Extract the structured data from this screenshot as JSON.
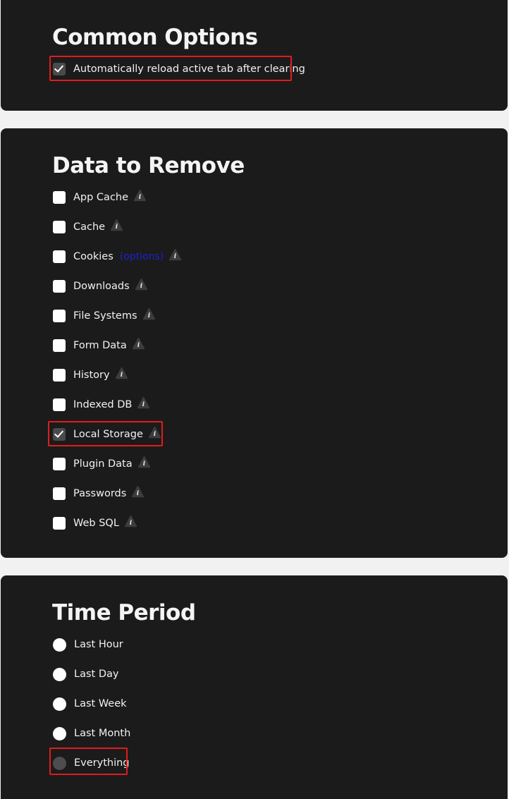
{
  "common": {
    "title": "Common Options",
    "options": [
      {
        "label": "Automatically reload active tab after clearing",
        "checked": true
      }
    ]
  },
  "data_to_remove": {
    "title": "Data to Remove",
    "options_link": "(options)",
    "items": [
      {
        "label": "App Cache",
        "checked": false
      },
      {
        "label": "Cache",
        "checked": false
      },
      {
        "label": "Cookies",
        "checked": false
      },
      {
        "label": "Downloads",
        "checked": false
      },
      {
        "label": "File Systems",
        "checked": false
      },
      {
        "label": "Form Data",
        "checked": false
      },
      {
        "label": "History",
        "checked": false
      },
      {
        "label": "Indexed DB",
        "checked": false
      },
      {
        "label": "Local Storage",
        "checked": true
      },
      {
        "label": "Plugin Data",
        "checked": false
      },
      {
        "label": "Passwords",
        "checked": false
      },
      {
        "label": "Web SQL",
        "checked": false
      }
    ]
  },
  "time_period": {
    "title": "Time Period",
    "options": [
      {
        "label": "Last Hour",
        "selected": false
      },
      {
        "label": "Last Day",
        "selected": false
      },
      {
        "label": "Last Week",
        "selected": false
      },
      {
        "label": "Last Month",
        "selected": false
      },
      {
        "label": "Everything",
        "selected": true
      }
    ]
  },
  "icons": {
    "info": "info-icon",
    "checkmark": "checkmark-icon"
  },
  "colors": {
    "panel_bg": "#1b1b1b",
    "page_bg": "#f1f1f1",
    "highlight": "#e01c1c",
    "link": "#1d22c9"
  }
}
